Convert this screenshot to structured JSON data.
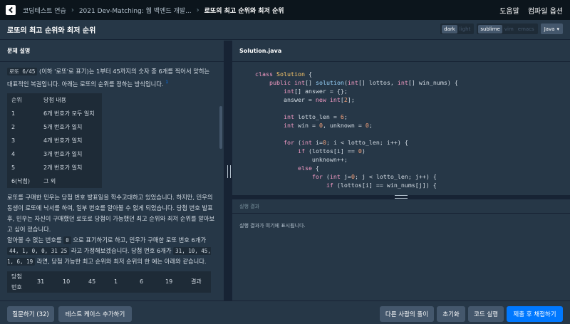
{
  "nav": {
    "breadcrumb_1": "코딩테스트 연습",
    "breadcrumb_2": "2021 Dev-Matching: 웹 백엔드 개발...",
    "breadcrumb_3": "로또의 최고 순위와 최저 순위",
    "help": "도움말",
    "compile_options": "컴파일 옵션"
  },
  "header": {
    "title": "로또의 최고 순위와 최저 순위",
    "theme_dark": "dark",
    "theme_light": "light",
    "keymap_sublime": "sublime",
    "keymap_vim": "vim",
    "keymap_emacs": "emacs",
    "language": "Java"
  },
  "description": {
    "heading": "문제 설명",
    "p1_code": "로또 6/45",
    "p1_text": "(이하 '로또'로 표기)는 1부터 45까지의 숫자 중 6개를 찍어서 맞히는 대표적인 복권입니다. 아래는 로또의 순위를 정하는 방식입니다.",
    "p1_fn": "1",
    "rank_table": {
      "headers": [
        "순위",
        "당첨 내용"
      ],
      "rows": [
        [
          "1",
          "6개 번호가 모두 일치"
        ],
        [
          "2",
          "5개 번호가 일치"
        ],
        [
          "3",
          "4개 번호가 일치"
        ],
        [
          "4",
          "3개 번호가 일치"
        ],
        [
          "5",
          "2개 번호가 일치"
        ],
        [
          "6(낙첨)",
          "그 외"
        ]
      ]
    },
    "p2": "로또를 구매한 민우는 당첨 번호 발표일을 학수고대하고 있었습니다. 하지만, 민우의 동생이 로또에 낙서를 하여, 일부 번호를 알아볼 수 없게 되었습니다. 당첨 번호 발표 후, 민우는 자신이 구매했던 로또로 당첨이 가능했던 최고 순위와 최저 순위를 알아보고 싶어 졌습니다.",
    "p3_a": "알아볼 수 없는 번호를",
    "p3_zero": "0",
    "p3_b": "으로 표기하기로 하고, 민우가 구매한 로또 번호 6개가",
    "p3_lottos": "44, 1, 0, 0, 31 25",
    "p3_c": "라고 가정해보겠습니다. 당첨 번호 6개가",
    "p3_win": "31, 10, 45, 1, 6, 19",
    "p3_d": "라면, 당첨 가능한 최고 순위와 최저 순위의 한 예는 아래와 같습니다.",
    "example_table": [
      "당첨 번호",
      "31",
      "10",
      "45",
      "1",
      "6",
      "19",
      "결과"
    ]
  },
  "editor": {
    "filename": "Solution.java",
    "lines": [
      "class Solution {",
      "    public int[] solution(int[] lottos, int[] win_nums) {",
      "        int[] answer = {};",
      "        answer = new int[2];",
      "",
      "        int lotto_len = 6;",
      "        int win = 0, unknown = 0;",
      "",
      "        for (int i=0; i < lotto_len; i++) {",
      "            if (lottos[i] == 0)",
      "                unknown++;",
      "            else {",
      "                for (int j=0; j < lotto_len; j++) {",
      "                    if (lottos[i] == win_nums[j]) {"
    ]
  },
  "result": {
    "heading": "실행 결과",
    "placeholder": "실행 결과가 여기에 표시됩니다."
  },
  "footer": {
    "ask": "질문하기 (32)",
    "add_test": "테스트 케이스 추가하기",
    "others": "다른 사람의 풀이",
    "reset": "초기화",
    "run": "코드 실행",
    "submit": "제출 후 채점하기"
  },
  "colors": {
    "background": "#263747",
    "nav_background": "#0c151c",
    "primary_button": "#0078ff",
    "secondary_button": "#44576c"
  }
}
